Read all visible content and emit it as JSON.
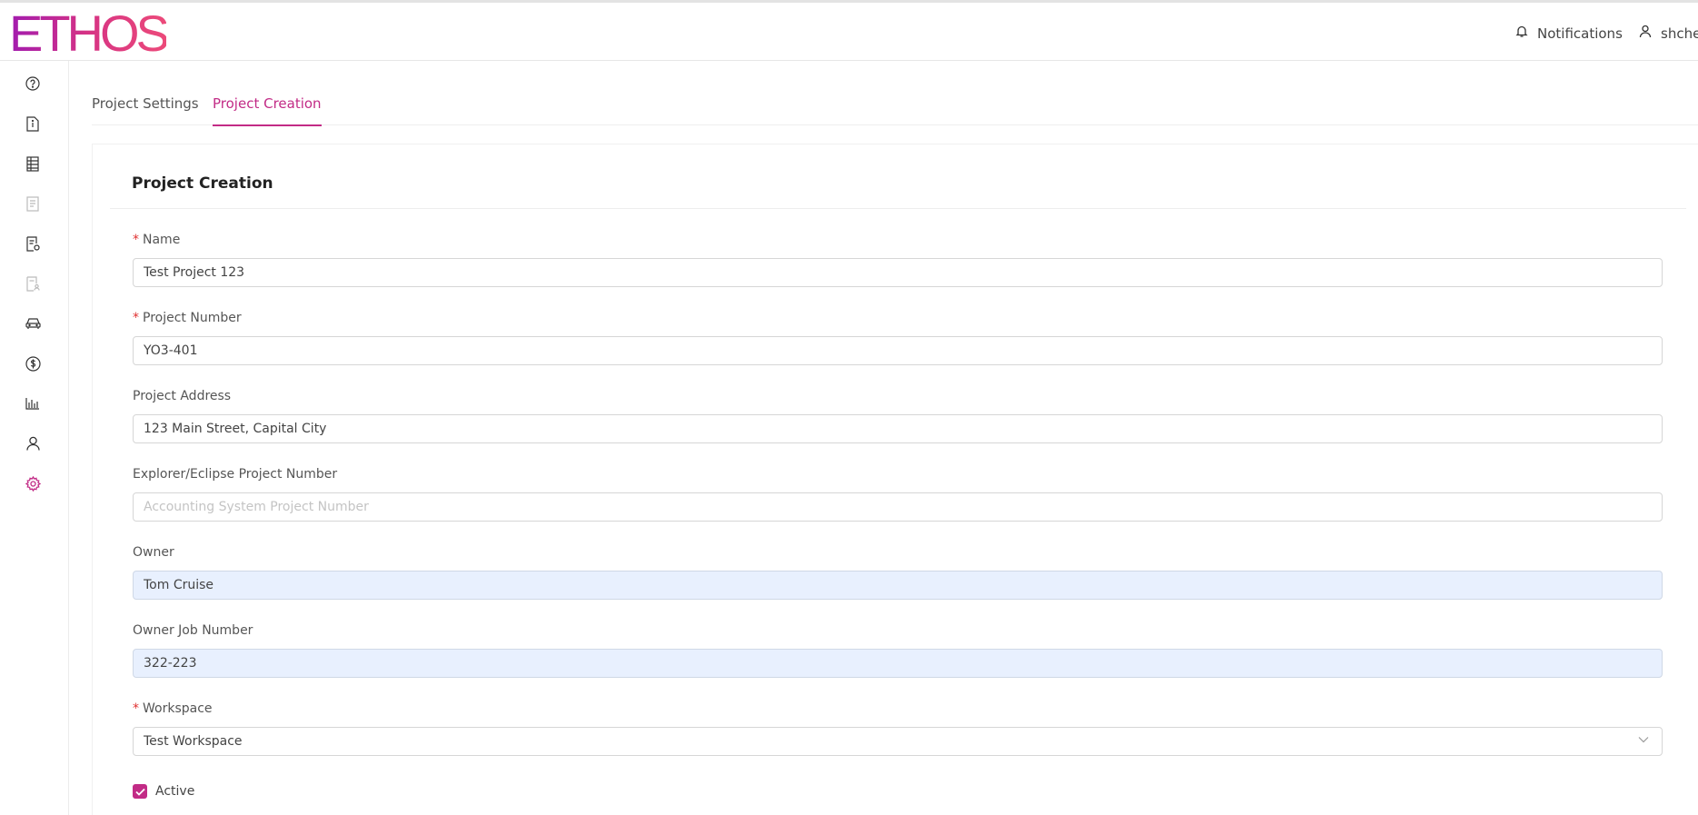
{
  "app": {
    "logo_text": "ETHOS",
    "brand_color": "#c22b86"
  },
  "header": {
    "notifications_label": "Notifications",
    "user_label": "shcheo"
  },
  "sidebar": {
    "items": [
      {
        "icon": "help-circle-icon"
      },
      {
        "icon": "document-info-icon"
      },
      {
        "icon": "ledger-icon"
      },
      {
        "icon": "report-disabled-icon"
      },
      {
        "icon": "document-settings-icon"
      },
      {
        "icon": "document-user-disabled-icon"
      },
      {
        "icon": "car-icon"
      },
      {
        "icon": "dollar-circle-icon"
      },
      {
        "icon": "bar-chart-icon"
      },
      {
        "icon": "user-icon"
      },
      {
        "icon": "gear-icon",
        "active": true
      }
    ]
  },
  "tabs": [
    {
      "label": "Project Settings",
      "active": false
    },
    {
      "label": "Project Creation",
      "active": true
    }
  ],
  "form": {
    "title": "Project Creation",
    "name": {
      "label": "Name",
      "required": true,
      "value": "Test Project 123"
    },
    "project_number": {
      "label": "Project Number",
      "required": true,
      "value": "YO3-401"
    },
    "project_address": {
      "label": "Project Address",
      "required": false,
      "value": "123 Main Street, Capital City"
    },
    "explorer_number": {
      "label": "Explorer/Eclipse Project Number",
      "required": false,
      "value": "",
      "placeholder": "Accounting System Project Number"
    },
    "owner": {
      "label": "Owner",
      "required": false,
      "value": "Tom Cruise"
    },
    "owner_job_number": {
      "label": "Owner Job Number",
      "required": false,
      "value": "322-223"
    },
    "workspace": {
      "label": "Workspace",
      "required": true,
      "value": "Test Workspace"
    },
    "active": {
      "label": "Active",
      "checked": true
    }
  },
  "colors": {
    "required_star": "#e03131",
    "autofill_bg": "#e8f0fe",
    "accent": "#c22b86"
  }
}
